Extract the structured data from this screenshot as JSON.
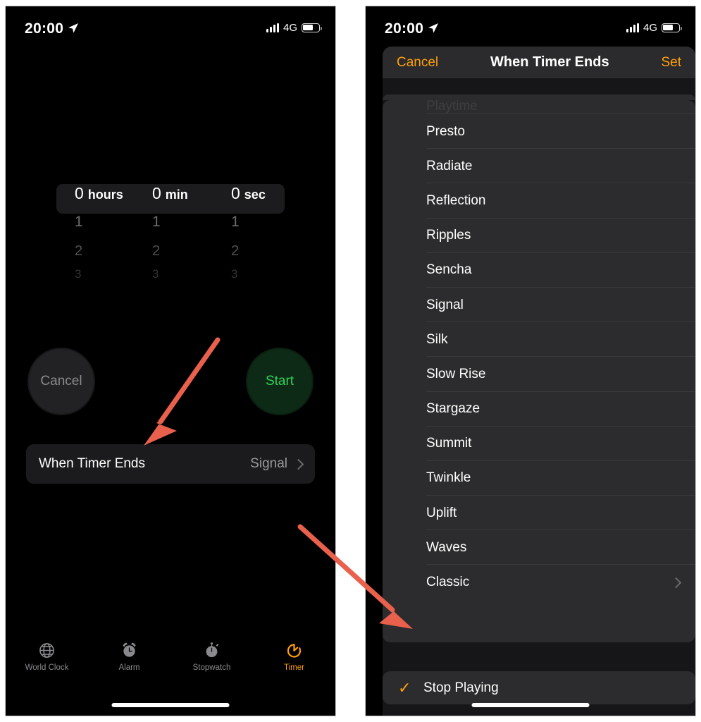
{
  "statusbar": {
    "time": "20:00",
    "network": "4G",
    "location_icon": "location-arrow-icon",
    "signal_icon": "signal-bars-icon",
    "battery_icon": "battery-icon"
  },
  "left_screen": {
    "app": "Clock",
    "picker": {
      "columns": [
        {
          "selected": "0",
          "unit": "hours",
          "below": [
            "1",
            "2",
            "3"
          ]
        },
        {
          "selected": "0",
          "unit": "min",
          "below": [
            "1",
            "2",
            "3"
          ]
        },
        {
          "selected": "0",
          "unit": "sec",
          "below": [
            "1",
            "2",
            "3"
          ]
        }
      ]
    },
    "buttons": {
      "cancel": "Cancel",
      "start": "Start",
      "cancel_color": "#8a8a8e",
      "start_color": "#35d05a"
    },
    "when_timer_ends": {
      "label": "When Timer Ends",
      "value": "Signal",
      "chevron_icon": "chevron-right-icon"
    },
    "tabs": [
      {
        "label": "World Clock",
        "icon": "globe-icon",
        "active": false
      },
      {
        "label": "Alarm",
        "icon": "alarm-clock-icon",
        "active": false
      },
      {
        "label": "Stopwatch",
        "icon": "stopwatch-icon",
        "active": false
      },
      {
        "label": "Timer",
        "icon": "timer-icon",
        "active": true
      }
    ],
    "active_tab_color": "#ff9f0a"
  },
  "right_screen": {
    "sheet": {
      "cancel_label": "Cancel",
      "title": "When Timer Ends",
      "set_label": "Set",
      "accent_color": "#ff9f0a"
    },
    "tones": [
      {
        "name": "Playtime",
        "clipped": true,
        "chevron": false
      },
      {
        "name": "Presto",
        "clipped": false,
        "chevron": false
      },
      {
        "name": "Radiate",
        "clipped": false,
        "chevron": false
      },
      {
        "name": "Reflection",
        "clipped": false,
        "chevron": false
      },
      {
        "name": "Ripples",
        "clipped": false,
        "chevron": false
      },
      {
        "name": "Sencha",
        "clipped": false,
        "chevron": false
      },
      {
        "name": "Signal",
        "clipped": false,
        "chevron": false
      },
      {
        "name": "Silk",
        "clipped": false,
        "chevron": false
      },
      {
        "name": "Slow Rise",
        "clipped": false,
        "chevron": false
      },
      {
        "name": "Stargaze",
        "clipped": false,
        "chevron": false
      },
      {
        "name": "Summit",
        "clipped": false,
        "chevron": false
      },
      {
        "name": "Twinkle",
        "clipped": false,
        "chevron": false
      },
      {
        "name": "Uplift",
        "clipped": false,
        "chevron": false
      },
      {
        "name": "Waves",
        "clipped": false,
        "chevron": false
      },
      {
        "name": "Classic",
        "clipped": false,
        "chevron": true
      }
    ],
    "stop_playing": {
      "label": "Stop Playing",
      "checked": true,
      "check_icon": "checkmark-icon"
    }
  },
  "annotations": {
    "arrow_color": "#e9604c",
    "arrows": [
      {
        "name": "arrow-to-when-timer-ends",
        "from": [
          307,
          484
        ],
        "to": [
          210,
          622
        ]
      },
      {
        "name": "arrow-to-stop-playing",
        "from": [
          424,
          745
        ],
        "to": [
          582,
          888
        ]
      }
    ]
  }
}
